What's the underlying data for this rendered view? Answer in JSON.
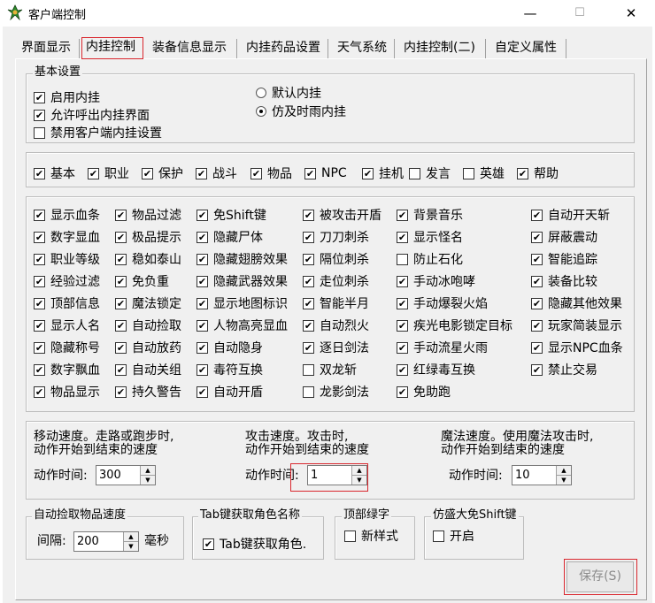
{
  "window": {
    "title": "客户端控制",
    "min": "—",
    "max": "☐",
    "close": "✕"
  },
  "tabs": [
    "界面显示",
    "内挂控制",
    "装备信息显示",
    "内挂药品设置",
    "天气系统",
    "内挂控制(二)",
    "自定义属性"
  ],
  "basic": {
    "legend": "基本设置",
    "checks": [
      {
        "label": "启用内挂",
        "checked": true
      },
      {
        "label": "允许呼出内挂界面",
        "checked": true
      },
      {
        "label": "禁用客户端内挂设置",
        "checked": false
      }
    ],
    "radios": [
      {
        "label": "默认内挂",
        "selected": false
      },
      {
        "label": "仿及时雨内挂",
        "selected": true
      }
    ]
  },
  "categories": [
    {
      "label": "基本",
      "checked": true
    },
    {
      "label": "职业",
      "checked": true
    },
    {
      "label": "保护",
      "checked": true
    },
    {
      "label": "战斗",
      "checked": true
    },
    {
      "label": "物品",
      "checked": true
    },
    {
      "label": "NPC",
      "checked": true
    },
    {
      "label": "挂机",
      "checked": true
    },
    {
      "label": "发言",
      "checked": false
    },
    {
      "label": "英雄",
      "checked": false
    },
    {
      "label": "帮助",
      "checked": true
    }
  ],
  "options": [
    [
      {
        "label": "显示血条",
        "checked": true
      },
      {
        "label": "数字显血",
        "checked": true
      },
      {
        "label": "职业等级",
        "checked": true
      },
      {
        "label": "经验过滤",
        "checked": true
      },
      {
        "label": "顶部信息",
        "checked": true
      },
      {
        "label": "显示人名",
        "checked": true
      },
      {
        "label": "隐藏称号",
        "checked": true
      },
      {
        "label": "数字飘血",
        "checked": true
      },
      {
        "label": "物品显示",
        "checked": true
      }
    ],
    [
      {
        "label": "物品过滤",
        "checked": true
      },
      {
        "label": "极品提示",
        "checked": true
      },
      {
        "label": "稳如泰山",
        "checked": true
      },
      {
        "label": "免负重",
        "checked": true
      },
      {
        "label": "魔法锁定",
        "checked": true
      },
      {
        "label": "自动捡取",
        "checked": true
      },
      {
        "label": "自动放药",
        "checked": true
      },
      {
        "label": "自动关组",
        "checked": true
      },
      {
        "label": "持久警告",
        "checked": true
      }
    ],
    [
      {
        "label": "免Shift键",
        "checked": true
      },
      {
        "label": "隐藏尸体",
        "checked": true
      },
      {
        "label": "隐藏翅膀效果",
        "checked": true
      },
      {
        "label": "隐藏武器效果",
        "checked": true
      },
      {
        "label": "显示地图标识",
        "checked": true
      },
      {
        "label": "人物高亮显血",
        "checked": true
      },
      {
        "label": "自动隐身",
        "checked": true
      },
      {
        "label": "毒符互换",
        "checked": true
      },
      {
        "label": "自动开盾",
        "checked": true
      }
    ],
    [
      {
        "label": "被攻击开盾",
        "checked": true
      },
      {
        "label": "刀刀刺杀",
        "checked": true
      },
      {
        "label": "隔位刺杀",
        "checked": true
      },
      {
        "label": "走位刺杀",
        "checked": true
      },
      {
        "label": "智能半月",
        "checked": true
      },
      {
        "label": "自动烈火",
        "checked": true
      },
      {
        "label": "逐日剑法",
        "checked": true
      },
      {
        "label": "双龙斩",
        "checked": false
      },
      {
        "label": "龙影剑法",
        "checked": false
      }
    ],
    [
      {
        "label": "背景音乐",
        "checked": true
      },
      {
        "label": "显示怪名",
        "checked": true
      },
      {
        "label": "防止石化",
        "checked": false
      },
      {
        "label": "手动冰咆哮",
        "checked": true
      },
      {
        "label": "手动爆裂火焰",
        "checked": true
      },
      {
        "label": "疾光电影锁定目标",
        "checked": true
      },
      {
        "label": "手动流星火雨",
        "checked": true
      },
      {
        "label": "红绿毒互换",
        "checked": true
      },
      {
        "label": "免助跑",
        "checked": true
      }
    ],
    [
      {
        "label": "自动开天斩",
        "checked": true
      },
      {
        "label": "屏蔽震动",
        "checked": true
      },
      {
        "label": "智能追踪",
        "checked": true
      },
      {
        "label": "装备比较",
        "checked": true
      },
      {
        "label": "隐藏其他效果",
        "checked": true
      },
      {
        "label": "玩家简装显示",
        "checked": true
      },
      {
        "label": "显示NPC血条",
        "checked": true
      },
      {
        "label": "禁止交易",
        "checked": true
      }
    ]
  ],
  "speed": {
    "move": {
      "desc1": "移动速度。走路或跑步时,",
      "desc2": "动作开始到结束的速度",
      "label": "动作时间:",
      "value": "300"
    },
    "attack": {
      "desc1": "攻击速度。攻击时,",
      "desc2": "动作开始到结束的速度",
      "label": "动作时间:",
      "value": "1"
    },
    "magic": {
      "desc1": "魔法速度。使用魔法攻击时,",
      "desc2": "动作开始到结束的速度",
      "label": "动作时间:",
      "value": "10"
    }
  },
  "pickup": {
    "legend": "自动捡取物品速度",
    "label": "间隔:",
    "value": "200",
    "unit": "毫秒"
  },
  "tabname": {
    "legend": "Tab键获取角色名称",
    "label": "Tab键获取角色.",
    "checked": true
  },
  "topgreen": {
    "legend": "顶部绿字",
    "label": "新样式",
    "checked": false
  },
  "shift": {
    "legend": "仿盛大免Shift键",
    "label": "开启",
    "checked": false
  },
  "save_label": "保存(S)"
}
